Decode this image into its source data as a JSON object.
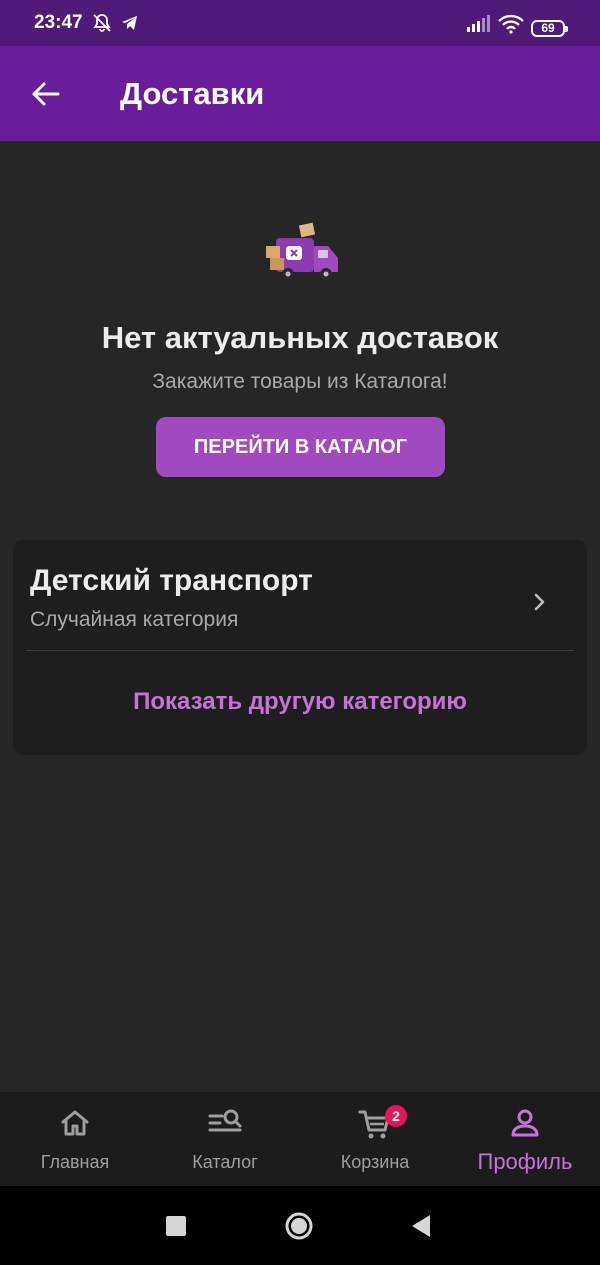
{
  "status_bar": {
    "time": "23:47",
    "battery": "69"
  },
  "app_bar": {
    "title": "Доставки",
    "back_icon": "arrow-left-icon"
  },
  "empty_state": {
    "illustration": "delivery-truck-illustration",
    "title": "Нет актуальных доставок",
    "subtitle": "Закажите товары из Каталога!",
    "button_label": "ПЕРЕЙТИ В КАТАЛОГ"
  },
  "category_card": {
    "title": "Детский транспорт",
    "subtitle": "Случайная категория",
    "link_label": "Показать другую категорию"
  },
  "bottom_nav": {
    "items": [
      {
        "label": "Главная",
        "icon": "home-icon",
        "active": false
      },
      {
        "label": "Каталог",
        "icon": "catalog-search-icon",
        "active": false
      },
      {
        "label": "Корзина",
        "icon": "cart-icon",
        "active": false,
        "badge": "2"
      },
      {
        "label": "Профиль",
        "icon": "profile-icon",
        "active": true
      }
    ]
  },
  "colors": {
    "accent": "#a14ac0",
    "app_bar": "#6a1d9a",
    "status_bar": "#4f1a78",
    "badge": "#e8145a",
    "active_nav": "#c772d6"
  }
}
